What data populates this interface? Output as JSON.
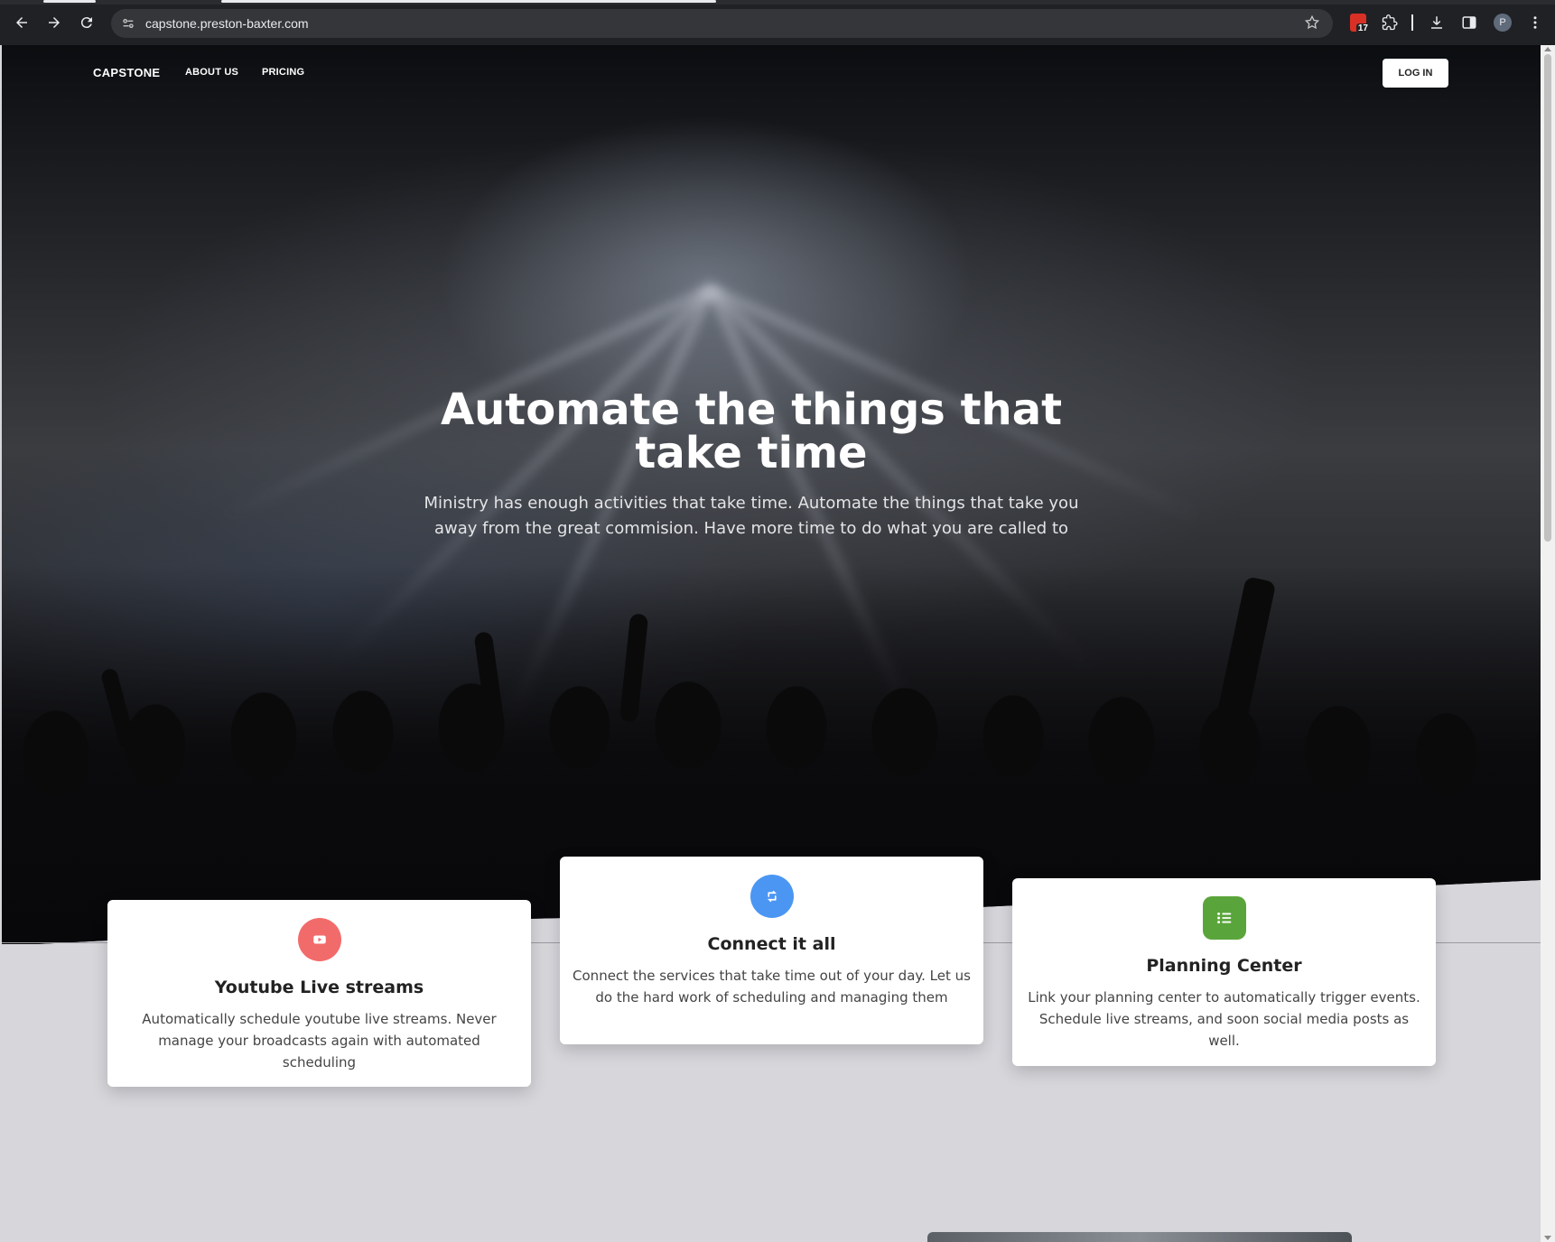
{
  "browser": {
    "url": "capstone.preston-baxter.com",
    "calendar_badge": "17",
    "profile_initial": "P"
  },
  "nav": {
    "brand": "CAPSTONE",
    "links": [
      "ABOUT US",
      "PRICING"
    ],
    "login": "LOG IN"
  },
  "hero": {
    "title_line1": "Automate the things that",
    "title_line2": "take time",
    "subtitle_line1": "Ministry has enough activities that take time. Automate the things that take you",
    "subtitle_line2": "away from the great commision. Have more time to do what you are called to"
  },
  "features": [
    {
      "icon": "youtube-icon",
      "color": "#f26b6b",
      "title": "Youtube Live streams",
      "body": "Automatically schedule youtube live streams. Never manage your broadcasts again with automated scheduling"
    },
    {
      "icon": "sync-icon",
      "color": "#4b96f3",
      "title": "Connect it all",
      "body": "Connect the services that take time out of your day. Let us do the hard work of scheduling and managing them"
    },
    {
      "icon": "list-icon",
      "color": "#5aa53b",
      "title": "Planning Center",
      "body": "Link your planning center to automatically trigger events. Schedule live streams, and soon social media posts as well."
    }
  ]
}
